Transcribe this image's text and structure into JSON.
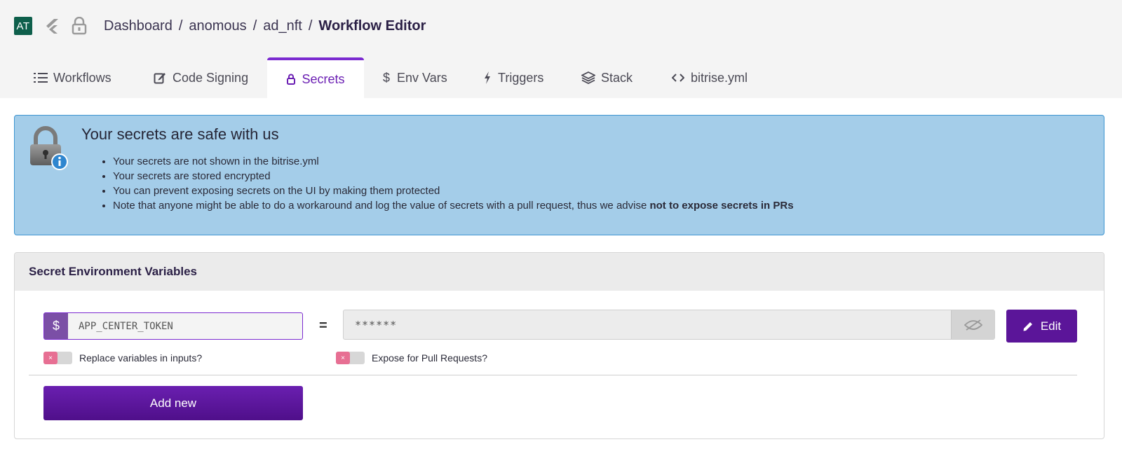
{
  "header": {
    "avatar_initials": "AT",
    "breadcrumb": [
      {
        "label": "Dashboard"
      },
      {
        "label": "anomous"
      },
      {
        "label": "ad_nft"
      }
    ],
    "current": "Workflow Editor",
    "separator": "/"
  },
  "tabs": [
    {
      "label": "Workflows",
      "icon": "list-icon"
    },
    {
      "label": "Code Signing",
      "icon": "edit-square-icon"
    },
    {
      "label": "Secrets",
      "icon": "lock-icon",
      "active": true
    },
    {
      "label": "Env Vars",
      "icon": "dollar-icon"
    },
    {
      "label": "Triggers",
      "icon": "bolt-icon"
    },
    {
      "label": "Stack",
      "icon": "layers-icon"
    },
    {
      "label": "bitrise.yml",
      "icon": "code-icon"
    }
  ],
  "info": {
    "title": "Your secrets are safe with us",
    "bullets": [
      "Your secrets are not shown in the bitrise.yml",
      "Your secrets are stored encrypted",
      "You can prevent exposing secrets on the UI by making them protected"
    ],
    "last_bullet_prefix": "Note that anyone might be able to do a workaround and log the value of secrets with a pull request, thus we advise ",
    "last_bullet_bold": "not to expose secrets in PRs"
  },
  "panel": {
    "title": "Secret Environment Variables",
    "secret": {
      "dollar": "$",
      "key": "APP_CENTER_TOKEN",
      "equals": "=",
      "value": "******",
      "edit_label": "Edit",
      "replace_label": "Replace variables in inputs?",
      "expose_label": "Expose for Pull Requests?",
      "toggle_off_mark": "×"
    },
    "add_new_label": "Add new"
  },
  "colors": {
    "accent": "#7b2ad0",
    "button": "#5b1599",
    "info_bg": "#a4cde9",
    "info_border": "#3e95d1",
    "avatar_bg": "#0e5f4b",
    "toggle_off": "#e76f93"
  }
}
